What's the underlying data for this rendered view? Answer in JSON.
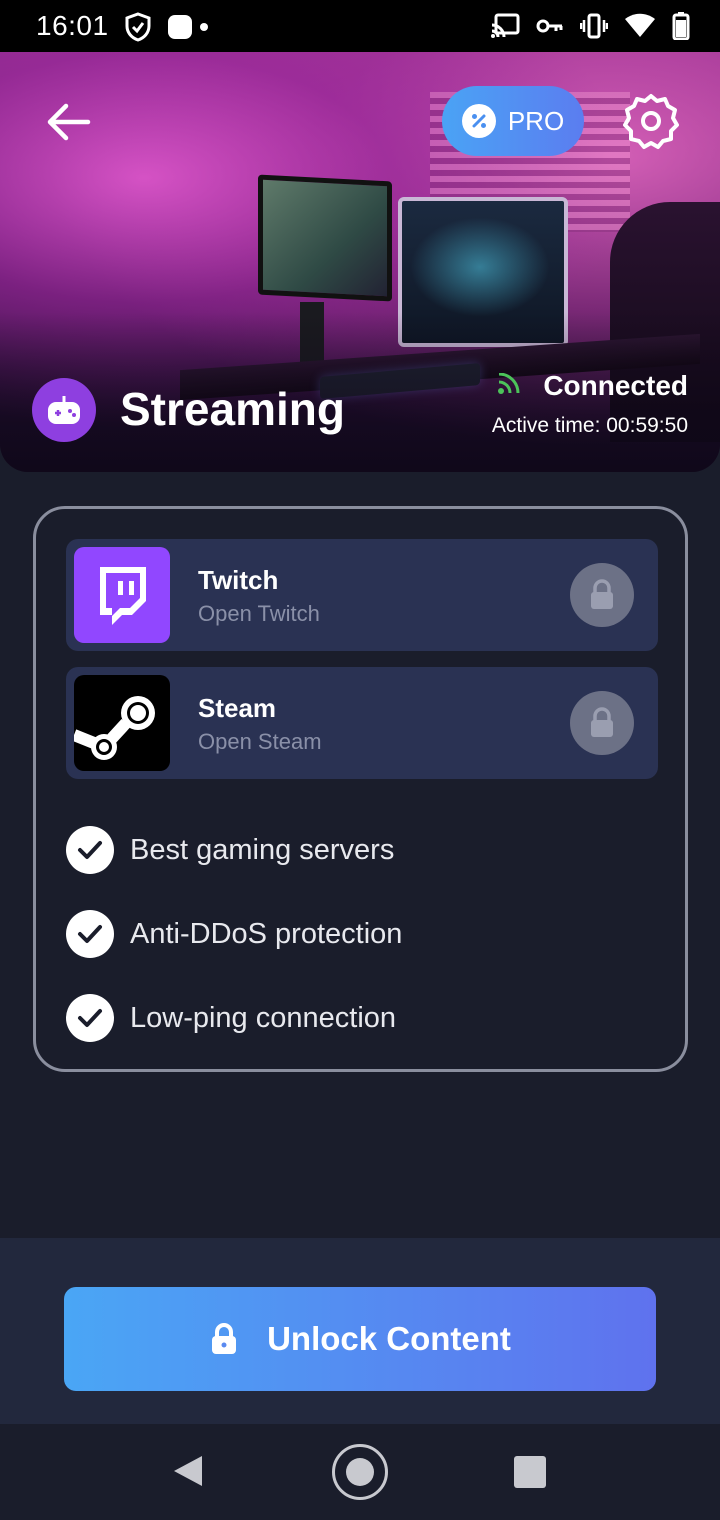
{
  "status_bar": {
    "time": "16:01",
    "left_icons": [
      "shield-check-icon",
      "notification-dot-icon"
    ],
    "right_icons": [
      "cast-icon",
      "vpn-key-icon",
      "vibrate-icon",
      "wifi-icon",
      "battery-icon"
    ]
  },
  "header": {
    "pro_label": "PRO",
    "mode_title": "Streaming",
    "connection_status": "Connected",
    "active_time": "Active time: 00:59:50"
  },
  "apps": [
    {
      "name": "Twitch",
      "subtitle": "Open Twitch",
      "brand_color": "#9147ff",
      "locked": true
    },
    {
      "name": "Steam",
      "subtitle": "Open Steam",
      "brand_color": "#000000",
      "locked": true
    }
  ],
  "features": [
    "Best gaming servers",
    "Anti-DDoS protection",
    "Low-ping connection"
  ],
  "cta": {
    "label": "Unlock Content"
  },
  "colors": {
    "background": "#1a1d2b",
    "card_row": "#2a3253",
    "accent_start": "#4aa6f5",
    "accent_end": "#5f72ee",
    "connected_green": "#4cc35a",
    "stream_icon_bg": "#8e3fe0"
  }
}
